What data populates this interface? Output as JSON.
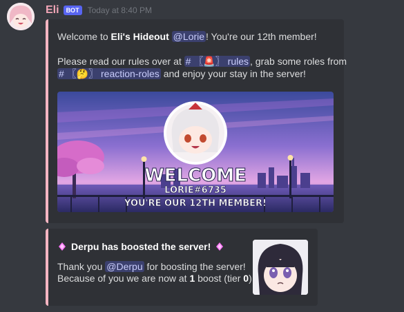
{
  "message": {
    "username": "Eli",
    "bot_tag": "BOT",
    "timestamp": "Today at 8:40 PM"
  },
  "welcome": {
    "line1_pre": "Welcome to ",
    "server_name": "Eli's Hideout",
    "line1_mid": " ",
    "user_mention": "@Lorie",
    "line1_post": "! You're our 12th member!",
    "line2_pre": "Please read our rules over at ",
    "rules_channel": "# 〖🚨〗 rules",
    "line2_mid": ", grab some roles from",
    "roles_channel": "# 〖🤔〗 reaction-roles",
    "line3_post": " and enjoy your stay in the server!",
    "banner_welcome": "WELCOME",
    "banner_user": "LORIE#6735",
    "banner_member": "YOU'RE OUR 12TH MEMBER!"
  },
  "boost": {
    "title": "Derpu has boosted the server!",
    "thanks_pre": "Thank you ",
    "user_mention": "@Derpu",
    "thanks_post": " for boosting the server!",
    "line2_pre": "Because of you we are now at ",
    "boost_count": "1",
    "line2_mid": " boost (tier ",
    "tier": "0",
    "line2_post": ")!"
  },
  "icons": {
    "gem": "boost-gem-icon"
  },
  "colors": {
    "accent": "#f5b5c2",
    "background": "#36393f",
    "embed": "#2f3136",
    "mention": "#c9cdfb",
    "bot_tag": "#5865f2"
  }
}
